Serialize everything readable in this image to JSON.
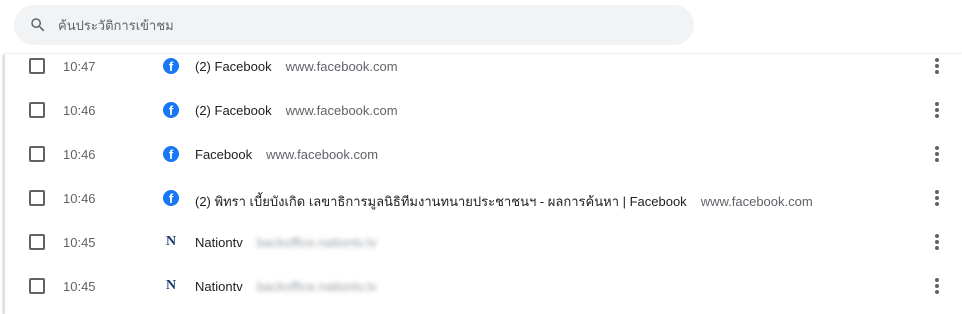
{
  "search": {
    "placeholder": "ค้นประวัติการเข้าชม",
    "icon": "search-icon"
  },
  "rows": [
    {
      "time": "10:47",
      "favicon": "facebook-icon",
      "title": "(2) Facebook",
      "domain": "www.facebook.com",
      "domain_blurred": false
    },
    {
      "time": "10:46",
      "favicon": "facebook-icon",
      "title": "(2) Facebook",
      "domain": "www.facebook.com",
      "domain_blurred": false
    },
    {
      "time": "10:46",
      "favicon": "facebook-icon",
      "title": "Facebook",
      "domain": "www.facebook.com",
      "domain_blurred": false
    },
    {
      "time": "10:46",
      "favicon": "facebook-icon",
      "title": "(2) พิทรา เบี้ยบังเกิด เลขาธิการมูลนิธิทีมงานทนายประชาชนฯ - ผลการค้นหา | Facebook",
      "domain": "www.facebook.com",
      "domain_blurred": false
    },
    {
      "time": "10:45",
      "favicon": "nationtv-icon",
      "title": "Nationtv",
      "domain": "backoffice.nationtv.tv",
      "domain_blurred": true
    },
    {
      "time": "10:45",
      "favicon": "nationtv-icon",
      "title": "Nationtv",
      "domain": "backoffice.nationtv.tv",
      "domain_blurred": true
    }
  ],
  "colors": {
    "accent": "#1877f2",
    "text_primary": "#202124",
    "text_secondary": "#5f6368",
    "search_bg": "#f1f3f4"
  }
}
